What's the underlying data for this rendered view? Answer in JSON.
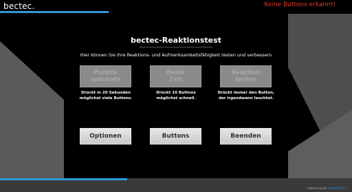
{
  "header": {
    "logo": "bectec.",
    "status_message": "Keine Buttons erkannt!"
  },
  "panel": {
    "title": "bectec-Reaktionstest",
    "subtitle": "Hier können Sie ihre Reaktions- und Aufmerksamkeitsfähigkeit testen und verbessern"
  },
  "modes": [
    {
      "label_line1": "Punkte",
      "label_line2": "sammeln",
      "desc_line1": "Drückt in 20 Sekunden",
      "desc_line2": "möglichst viele Buttons."
    },
    {
      "label_line1": "Beste",
      "label_line2": "Zeit",
      "desc_line1": "Drückt 10 Buttons",
      "desc_line2": "möglichst schnell."
    },
    {
      "label_line1": "Reaktion",
      "label_line2": "testen",
      "desc_line1": "Drückt immer den Button,",
      "desc_line2": "der irgendwann leuchtet."
    }
  ],
  "actions": {
    "options": "Optionen",
    "buttons": "Buttons",
    "quit": "Beenden"
  },
  "footer": {
    "feature_level_label": "Feature Level:",
    "feature_level_value": "Android 8.0.0"
  },
  "colors": {
    "accent": "#2e9bd6",
    "warning": "#e03a2c"
  }
}
